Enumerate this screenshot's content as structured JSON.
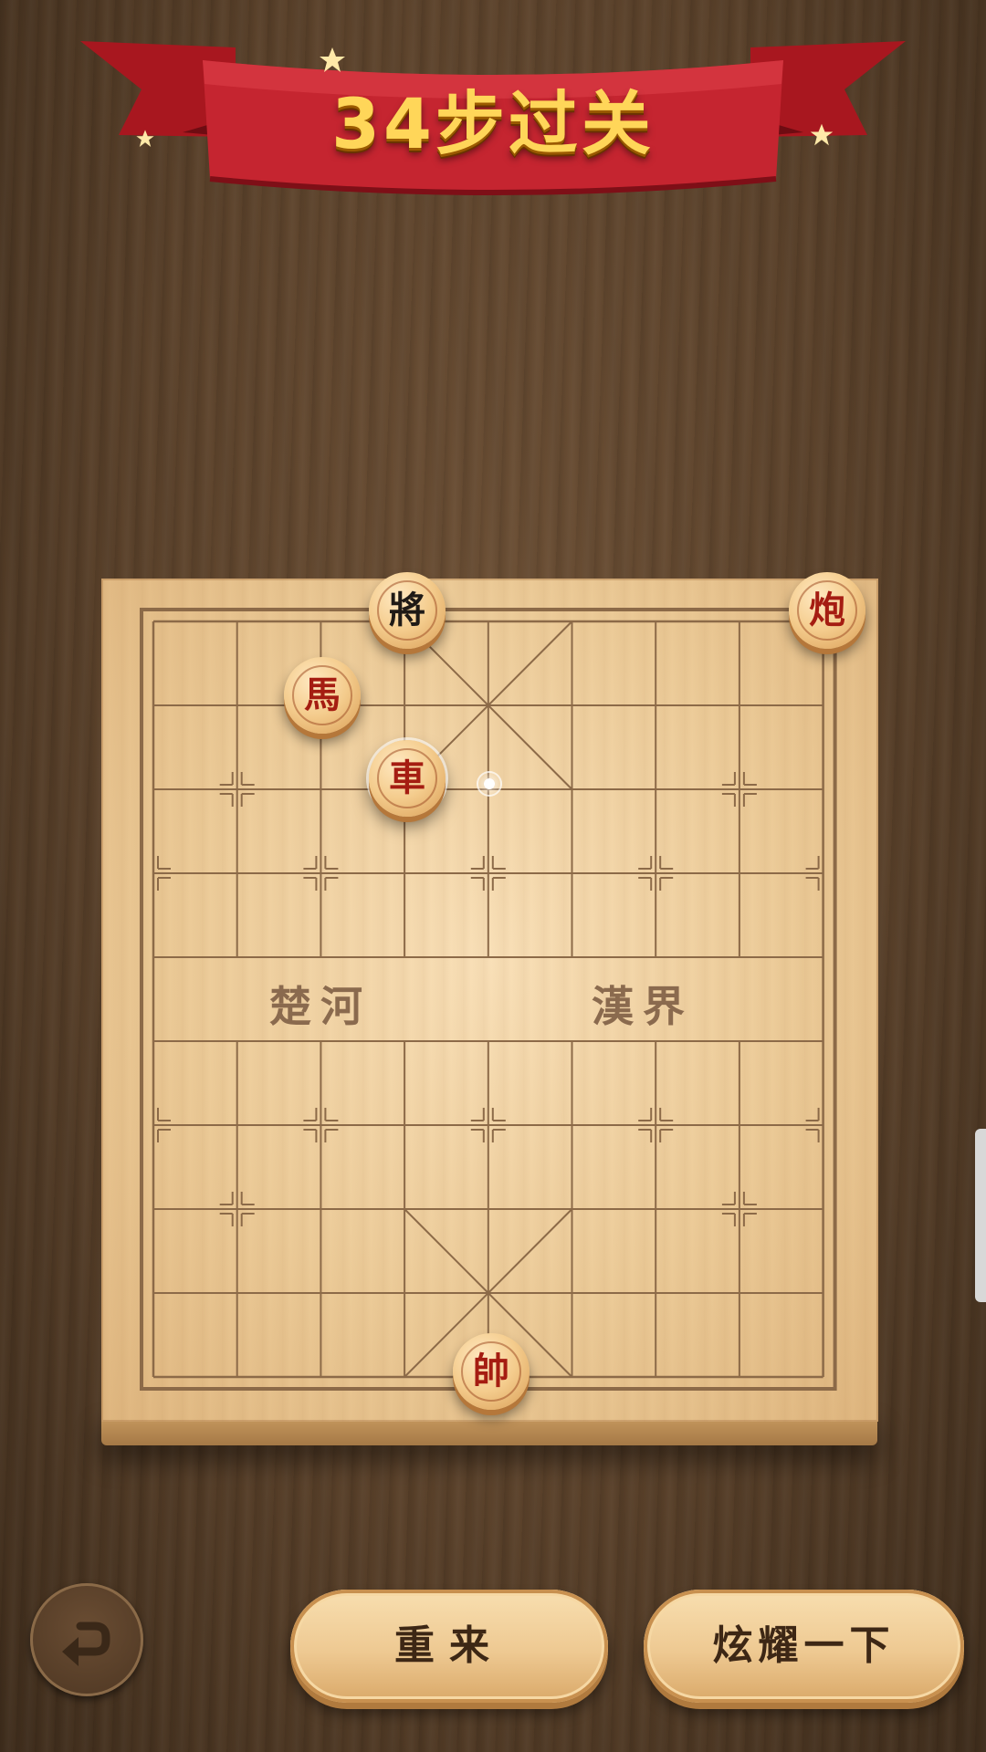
{
  "header": {
    "title": "34步过关"
  },
  "board": {
    "river_left": "楚河",
    "river_right": "漢界",
    "pieces": [
      {
        "name": "black-general",
        "glyph": "將",
        "side": "black"
      },
      {
        "name": "red-cannon",
        "glyph": "炮",
        "side": "red"
      },
      {
        "name": "red-horse",
        "glyph": "馬",
        "side": "red"
      },
      {
        "name": "red-chariot",
        "glyph": "車",
        "side": "red"
      },
      {
        "name": "red-general",
        "glyph": "帥",
        "side": "red"
      }
    ]
  },
  "controls": {
    "back_icon": "return-arrow-icon",
    "retry_label": "重来",
    "show_off_label": "炫耀一下"
  },
  "colors": {
    "red_piece": "#a51d12",
    "black_piece": "#1f1a16",
    "banner": "#c0232a",
    "title_gold": "#ffd659"
  }
}
